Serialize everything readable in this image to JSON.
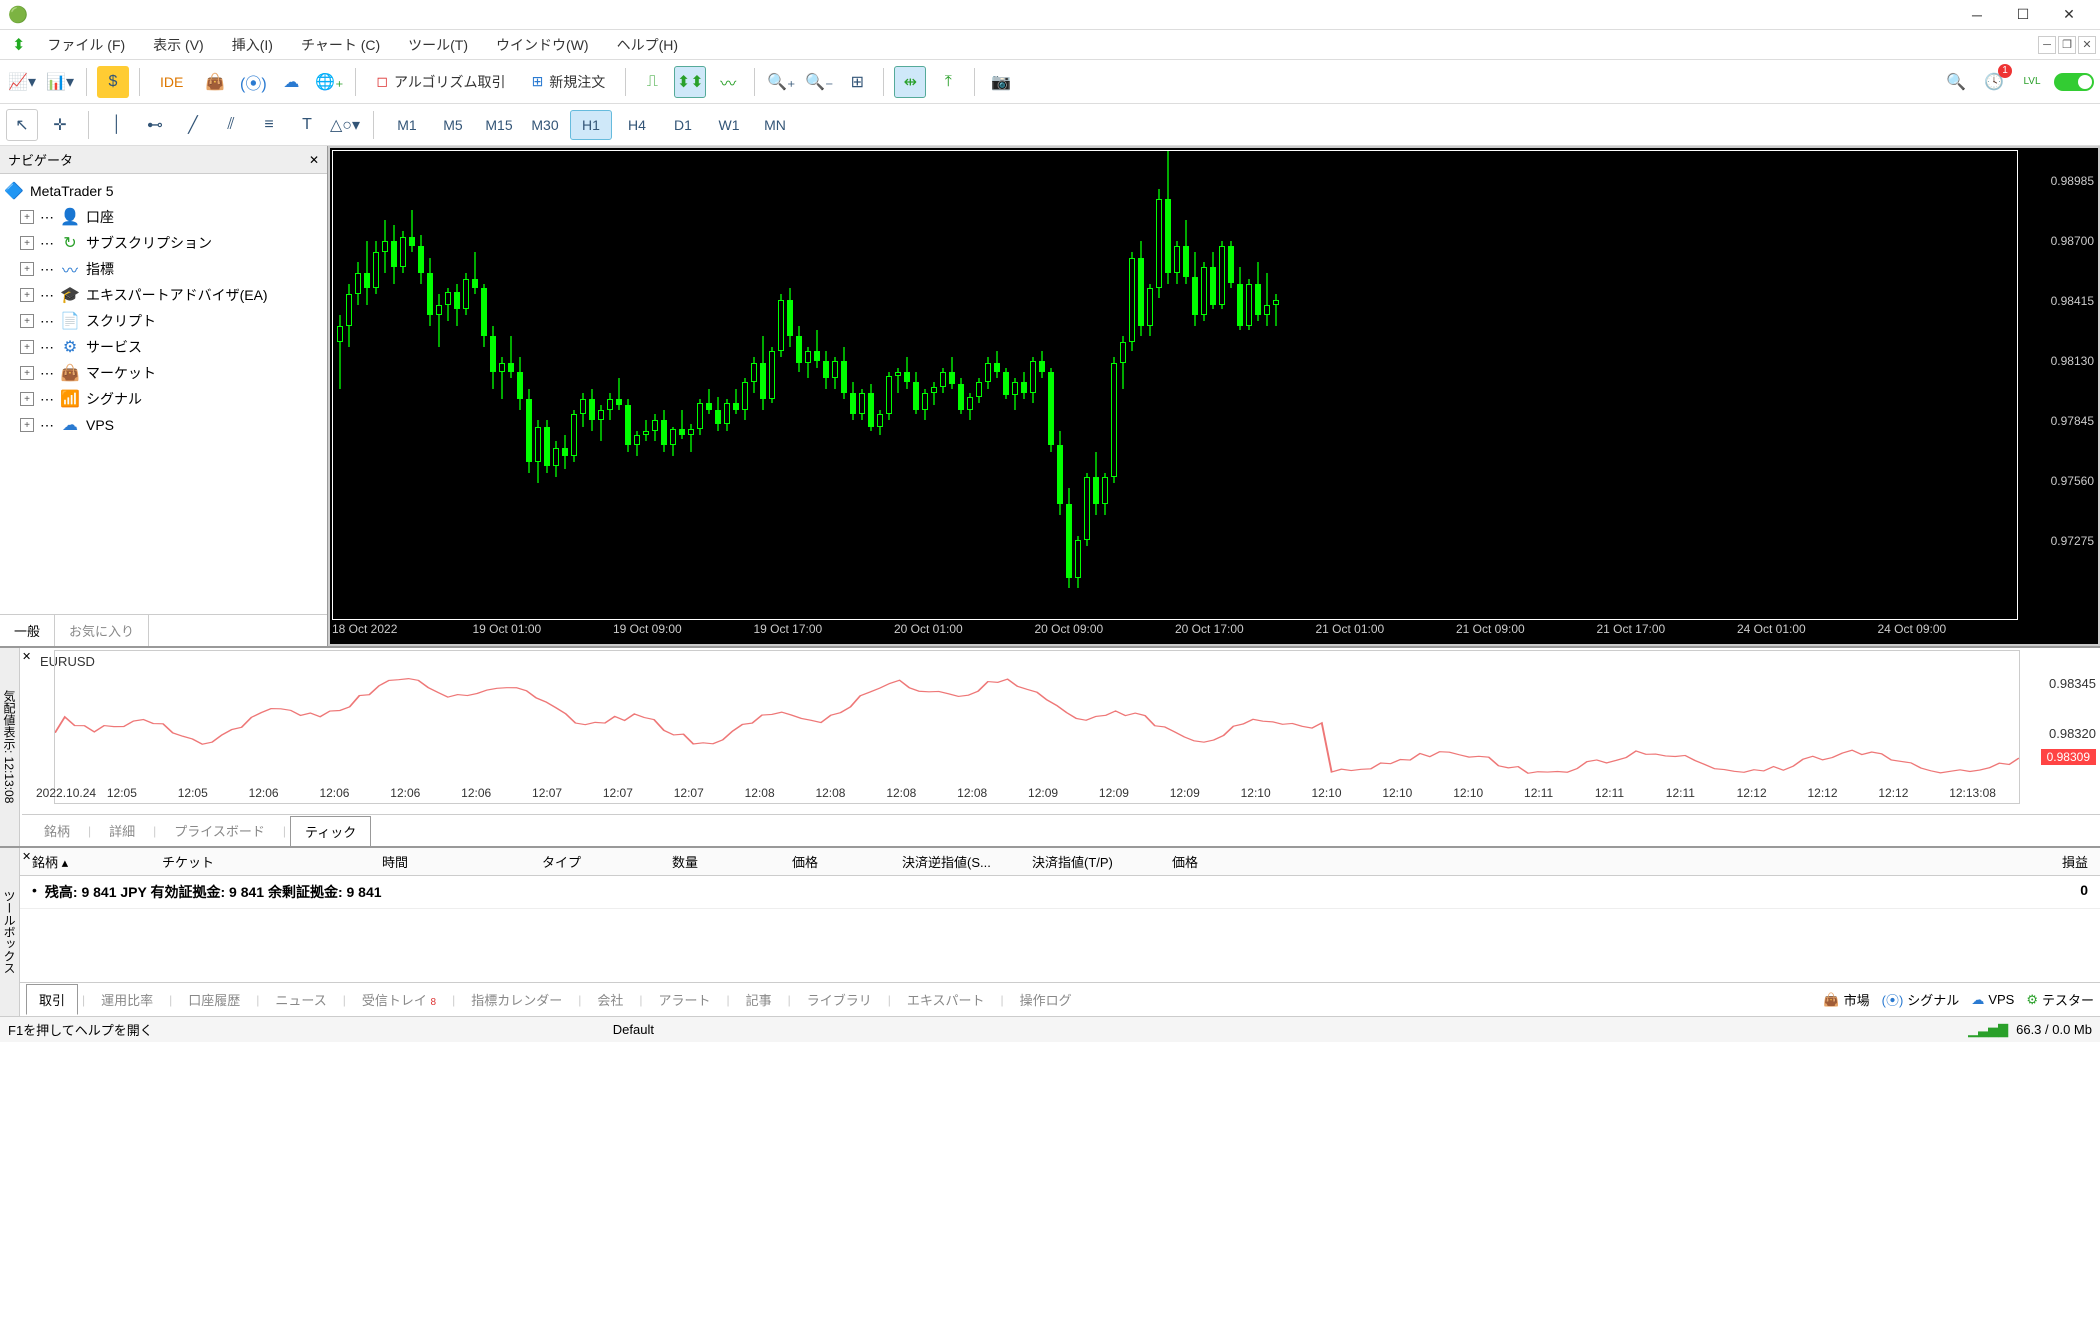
{
  "menubar": {
    "file": "ファイル (F)",
    "view": "表示 (V)",
    "insert": "挿入(I)",
    "chart": "チャート (C)",
    "tool": "ツール(T)",
    "window": "ウインドウ(W)",
    "help": "ヘルプ(H)"
  },
  "toolbar": {
    "ide": "IDE",
    "algo": "アルゴリズム取引",
    "neworder": "新規注文",
    "notif_count": "1"
  },
  "timeframes": [
    "M1",
    "M5",
    "M15",
    "M30",
    "H1",
    "H4",
    "D1",
    "W1",
    "MN"
  ],
  "timeframe_active": "H1",
  "navigator": {
    "title": "ナビゲータ",
    "root": "MetaTrader 5",
    "items": [
      {
        "label": "口座",
        "icon": "👤",
        "col": "#2a7ad1"
      },
      {
        "label": "サブスクリプション",
        "icon": "↻",
        "col": "#2aa02a"
      },
      {
        "label": "指標",
        "icon": "〰",
        "col": "#2a7ad1"
      },
      {
        "label": "エキスパートアドバイザ(EA)",
        "icon": "🎓",
        "col": "#2a7ad1"
      },
      {
        "label": "スクリプト",
        "icon": "📄",
        "col": "#e9a000"
      },
      {
        "label": "サービス",
        "icon": "⚙",
        "col": "#2a7ad1"
      },
      {
        "label": "マーケット",
        "icon": "👜",
        "col": "#e9a000"
      },
      {
        "label": "シグナル",
        "icon": "📶",
        "col": "#2a7ad1"
      },
      {
        "label": "VPS",
        "icon": "☁",
        "col": "#2a7ad1"
      }
    ],
    "tabs": {
      "general": "一般",
      "fav": "お気に入り"
    }
  },
  "chart_data": {
    "type": "candlestick",
    "symbol": "EURUSD",
    "timeframe": "H1",
    "ylim": [
      0.97,
      0.9913
    ],
    "yticks": [
      0.98985,
      0.987,
      0.98415,
      0.9813,
      0.97845,
      0.9756,
      0.97275
    ],
    "xticks": [
      "18 Oct 2022",
      "19 Oct 01:00",
      "19 Oct 09:00",
      "19 Oct 17:00",
      "20 Oct 01:00",
      "20 Oct 09:00",
      "20 Oct 17:00",
      "21 Oct 01:00",
      "21 Oct 09:00",
      "21 Oct 17:00",
      "24 Oct 01:00",
      "24 Oct 09:00"
    ],
    "candles": [
      {
        "o": 0.9822,
        "h": 0.9835,
        "l": 0.98,
        "c": 0.983,
        "d": "up"
      },
      {
        "o": 0.983,
        "h": 0.985,
        "l": 0.982,
        "c": 0.9845,
        "d": "up"
      },
      {
        "o": 0.9845,
        "h": 0.986,
        "l": 0.984,
        "c": 0.9855,
        "d": "up"
      },
      {
        "o": 0.9855,
        "h": 0.987,
        "l": 0.984,
        "c": 0.9848,
        "d": "dn"
      },
      {
        "o": 0.9848,
        "h": 0.987,
        "l": 0.9845,
        "c": 0.9865,
        "d": "up"
      },
      {
        "o": 0.9865,
        "h": 0.988,
        "l": 0.9855,
        "c": 0.987,
        "d": "up"
      },
      {
        "o": 0.987,
        "h": 0.9878,
        "l": 0.985,
        "c": 0.9858,
        "d": "dn"
      },
      {
        "o": 0.9858,
        "h": 0.9875,
        "l": 0.9855,
        "c": 0.9872,
        "d": "up"
      },
      {
        "o": 0.9872,
        "h": 0.9885,
        "l": 0.9865,
        "c": 0.9868,
        "d": "dn"
      },
      {
        "o": 0.9868,
        "h": 0.9873,
        "l": 0.985,
        "c": 0.9855,
        "d": "dn"
      },
      {
        "o": 0.9855,
        "h": 0.9862,
        "l": 0.983,
        "c": 0.9835,
        "d": "dn"
      },
      {
        "o": 0.9835,
        "h": 0.9845,
        "l": 0.982,
        "c": 0.984,
        "d": "up"
      },
      {
        "o": 0.984,
        "h": 0.9848,
        "l": 0.9832,
        "c": 0.9846,
        "d": "up"
      },
      {
        "o": 0.9846,
        "h": 0.985,
        "l": 0.983,
        "c": 0.9838,
        "d": "dn"
      },
      {
        "o": 0.9838,
        "h": 0.9855,
        "l": 0.9835,
        "c": 0.9852,
        "d": "up"
      },
      {
        "o": 0.9852,
        "h": 0.9865,
        "l": 0.9845,
        "c": 0.9848,
        "d": "dn"
      },
      {
        "o": 0.9848,
        "h": 0.985,
        "l": 0.982,
        "c": 0.9825,
        "d": "dn"
      },
      {
        "o": 0.9825,
        "h": 0.983,
        "l": 0.98,
        "c": 0.9808,
        "d": "dn"
      },
      {
        "o": 0.9808,
        "h": 0.9815,
        "l": 0.9795,
        "c": 0.9812,
        "d": "up"
      },
      {
        "o": 0.9812,
        "h": 0.9825,
        "l": 0.9805,
        "c": 0.9808,
        "d": "dn"
      },
      {
        "o": 0.9808,
        "h": 0.9815,
        "l": 0.979,
        "c": 0.9795,
        "d": "dn"
      },
      {
        "o": 0.9795,
        "h": 0.98,
        "l": 0.976,
        "c": 0.9765,
        "d": "dn"
      },
      {
        "o": 0.9765,
        "h": 0.9785,
        "l": 0.9755,
        "c": 0.9782,
        "d": "up"
      },
      {
        "o": 0.9782,
        "h": 0.9785,
        "l": 0.976,
        "c": 0.9763,
        "d": "dn"
      },
      {
        "o": 0.9763,
        "h": 0.9775,
        "l": 0.9758,
        "c": 0.9772,
        "d": "up"
      },
      {
        "o": 0.9772,
        "h": 0.9778,
        "l": 0.9762,
        "c": 0.9768,
        "d": "dn"
      },
      {
        "o": 0.9768,
        "h": 0.979,
        "l": 0.9765,
        "c": 0.9788,
        "d": "up"
      },
      {
        "o": 0.9788,
        "h": 0.9798,
        "l": 0.9782,
        "c": 0.9795,
        "d": "up"
      },
      {
        "o": 0.9795,
        "h": 0.98,
        "l": 0.978,
        "c": 0.9785,
        "d": "dn"
      },
      {
        "o": 0.9785,
        "h": 0.9792,
        "l": 0.9775,
        "c": 0.979,
        "d": "up"
      },
      {
        "o": 0.979,
        "h": 0.9798,
        "l": 0.9785,
        "c": 0.9795,
        "d": "up"
      },
      {
        "o": 0.9795,
        "h": 0.9805,
        "l": 0.979,
        "c": 0.9792,
        "d": "dn"
      },
      {
        "o": 0.9792,
        "h": 0.9795,
        "l": 0.977,
        "c": 0.9773,
        "d": "dn"
      },
      {
        "o": 0.9773,
        "h": 0.978,
        "l": 0.9768,
        "c": 0.9778,
        "d": "up"
      },
      {
        "o": 0.9778,
        "h": 0.9785,
        "l": 0.9775,
        "c": 0.978,
        "d": "up"
      },
      {
        "o": 0.978,
        "h": 0.9788,
        "l": 0.9775,
        "c": 0.9785,
        "d": "up"
      },
      {
        "o": 0.9785,
        "h": 0.979,
        "l": 0.977,
        "c": 0.9773,
        "d": "dn"
      },
      {
        "o": 0.9773,
        "h": 0.9782,
        "l": 0.9768,
        "c": 0.9781,
        "d": "up"
      },
      {
        "o": 0.9781,
        "h": 0.979,
        "l": 0.9776,
        "c": 0.9778,
        "d": "dn"
      },
      {
        "o": 0.9778,
        "h": 0.9783,
        "l": 0.977,
        "c": 0.9781,
        "d": "up"
      },
      {
        "o": 0.9781,
        "h": 0.9795,
        "l": 0.9778,
        "c": 0.9793,
        "d": "up"
      },
      {
        "o": 0.9793,
        "h": 0.98,
        "l": 0.9788,
        "c": 0.979,
        "d": "dn"
      },
      {
        "o": 0.979,
        "h": 0.9796,
        "l": 0.978,
        "c": 0.9783,
        "d": "dn"
      },
      {
        "o": 0.9783,
        "h": 0.9795,
        "l": 0.978,
        "c": 0.9793,
        "d": "up"
      },
      {
        "o": 0.9793,
        "h": 0.98,
        "l": 0.9788,
        "c": 0.979,
        "d": "dn"
      },
      {
        "o": 0.979,
        "h": 0.9805,
        "l": 0.9785,
        "c": 0.9803,
        "d": "up"
      },
      {
        "o": 0.9803,
        "h": 0.9815,
        "l": 0.9798,
        "c": 0.9812,
        "d": "up"
      },
      {
        "o": 0.9812,
        "h": 0.9825,
        "l": 0.979,
        "c": 0.9795,
        "d": "dn"
      },
      {
        "o": 0.9795,
        "h": 0.982,
        "l": 0.9793,
        "c": 0.9818,
        "d": "up"
      },
      {
        "o": 0.9818,
        "h": 0.9845,
        "l": 0.9815,
        "c": 0.9842,
        "d": "up"
      },
      {
        "o": 0.9842,
        "h": 0.9848,
        "l": 0.982,
        "c": 0.9825,
        "d": "dn"
      },
      {
        "o": 0.9825,
        "h": 0.983,
        "l": 0.9808,
        "c": 0.9812,
        "d": "dn"
      },
      {
        "o": 0.9812,
        "h": 0.982,
        "l": 0.9805,
        "c": 0.9818,
        "d": "up"
      },
      {
        "o": 0.9818,
        "h": 0.9828,
        "l": 0.981,
        "c": 0.9813,
        "d": "dn"
      },
      {
        "o": 0.9813,
        "h": 0.9818,
        "l": 0.98,
        "c": 0.9805,
        "d": "dn"
      },
      {
        "o": 0.9805,
        "h": 0.9815,
        "l": 0.98,
        "c": 0.9813,
        "d": "up"
      },
      {
        "o": 0.9813,
        "h": 0.982,
        "l": 0.9795,
        "c": 0.9798,
        "d": "dn"
      },
      {
        "o": 0.9798,
        "h": 0.9803,
        "l": 0.9785,
        "c": 0.9788,
        "d": "dn"
      },
      {
        "o": 0.9788,
        "h": 0.98,
        "l": 0.9785,
        "c": 0.9798,
        "d": "up"
      },
      {
        "o": 0.9798,
        "h": 0.9802,
        "l": 0.978,
        "c": 0.9782,
        "d": "dn"
      },
      {
        "o": 0.9782,
        "h": 0.979,
        "l": 0.9778,
        "c": 0.9788,
        "d": "up"
      },
      {
        "o": 0.9788,
        "h": 0.9808,
        "l": 0.9785,
        "c": 0.9806,
        "d": "up"
      },
      {
        "o": 0.9806,
        "h": 0.981,
        "l": 0.9798,
        "c": 0.9808,
        "d": "up"
      },
      {
        "o": 0.9808,
        "h": 0.9815,
        "l": 0.98,
        "c": 0.9803,
        "d": "dn"
      },
      {
        "o": 0.9803,
        "h": 0.9808,
        "l": 0.9788,
        "c": 0.979,
        "d": "dn"
      },
      {
        "o": 0.979,
        "h": 0.98,
        "l": 0.9785,
        "c": 0.9798,
        "d": "up"
      },
      {
        "o": 0.9798,
        "h": 0.9803,
        "l": 0.9792,
        "c": 0.9801,
        "d": "up"
      },
      {
        "o": 0.9801,
        "h": 0.981,
        "l": 0.9798,
        "c": 0.9808,
        "d": "up"
      },
      {
        "o": 0.9808,
        "h": 0.9815,
        "l": 0.98,
        "c": 0.9802,
        "d": "dn"
      },
      {
        "o": 0.9802,
        "h": 0.9805,
        "l": 0.9788,
        "c": 0.979,
        "d": "dn"
      },
      {
        "o": 0.979,
        "h": 0.9798,
        "l": 0.9785,
        "c": 0.9796,
        "d": "up"
      },
      {
        "o": 0.9796,
        "h": 0.9805,
        "l": 0.9793,
        "c": 0.9803,
        "d": "up"
      },
      {
        "o": 0.9803,
        "h": 0.9815,
        "l": 0.98,
        "c": 0.9812,
        "d": "up"
      },
      {
        "o": 0.9812,
        "h": 0.9818,
        "l": 0.9805,
        "c": 0.9808,
        "d": "dn"
      },
      {
        "o": 0.9808,
        "h": 0.981,
        "l": 0.9795,
        "c": 0.9797,
        "d": "dn"
      },
      {
        "o": 0.9797,
        "h": 0.9805,
        "l": 0.979,
        "c": 0.9803,
        "d": "up"
      },
      {
        "o": 0.9803,
        "h": 0.9808,
        "l": 0.9795,
        "c": 0.9798,
        "d": "dn"
      },
      {
        "o": 0.9798,
        "h": 0.9815,
        "l": 0.9793,
        "c": 0.9813,
        "d": "up"
      },
      {
        "o": 0.9813,
        "h": 0.9818,
        "l": 0.9805,
        "c": 0.9808,
        "d": "dn"
      },
      {
        "o": 0.9808,
        "h": 0.981,
        "l": 0.977,
        "c": 0.9773,
        "d": "dn"
      },
      {
        "o": 0.9773,
        "h": 0.978,
        "l": 0.974,
        "c": 0.9745,
        "d": "dn"
      },
      {
        "o": 0.9745,
        "h": 0.9753,
        "l": 0.9705,
        "c": 0.971,
        "d": "dn"
      },
      {
        "o": 0.971,
        "h": 0.973,
        "l": 0.9705,
        "c": 0.9728,
        "d": "up"
      },
      {
        "o": 0.9728,
        "h": 0.976,
        "l": 0.9725,
        "c": 0.9758,
        "d": "up"
      },
      {
        "o": 0.9758,
        "h": 0.977,
        "l": 0.974,
        "c": 0.9745,
        "d": "dn"
      },
      {
        "o": 0.9745,
        "h": 0.976,
        "l": 0.974,
        "c": 0.9758,
        "d": "up"
      },
      {
        "o": 0.9758,
        "h": 0.9815,
        "l": 0.9755,
        "c": 0.9812,
        "d": "up"
      },
      {
        "o": 0.9812,
        "h": 0.9825,
        "l": 0.98,
        "c": 0.9822,
        "d": "up"
      },
      {
        "o": 0.9822,
        "h": 0.9865,
        "l": 0.9818,
        "c": 0.9862,
        "d": "up"
      },
      {
        "o": 0.9862,
        "h": 0.987,
        "l": 0.9825,
        "c": 0.983,
        "d": "dn"
      },
      {
        "o": 0.983,
        "h": 0.985,
        "l": 0.9825,
        "c": 0.9848,
        "d": "up"
      },
      {
        "o": 0.9848,
        "h": 0.9895,
        "l": 0.9843,
        "c": 0.989,
        "d": "up"
      },
      {
        "o": 0.989,
        "h": 0.9913,
        "l": 0.985,
        "c": 0.9855,
        "d": "dn"
      },
      {
        "o": 0.9855,
        "h": 0.987,
        "l": 0.985,
        "c": 0.9868,
        "d": "up"
      },
      {
        "o": 0.9868,
        "h": 0.988,
        "l": 0.985,
        "c": 0.9853,
        "d": "dn"
      },
      {
        "o": 0.9853,
        "h": 0.9865,
        "l": 0.983,
        "c": 0.9835,
        "d": "dn"
      },
      {
        "o": 0.9835,
        "h": 0.986,
        "l": 0.9832,
        "c": 0.9858,
        "d": "up"
      },
      {
        "o": 0.9858,
        "h": 0.9865,
        "l": 0.9838,
        "c": 0.984,
        "d": "dn"
      },
      {
        "o": 0.984,
        "h": 0.987,
        "l": 0.9838,
        "c": 0.9868,
        "d": "up"
      },
      {
        "o": 0.9868,
        "h": 0.987,
        "l": 0.9848,
        "c": 0.985,
        "d": "dn"
      },
      {
        "o": 0.985,
        "h": 0.9858,
        "l": 0.9828,
        "c": 0.983,
        "d": "dn"
      },
      {
        "o": 0.983,
        "h": 0.9852,
        "l": 0.9828,
        "c": 0.985,
        "d": "up"
      },
      {
        "o": 0.985,
        "h": 0.986,
        "l": 0.9832,
        "c": 0.9835,
        "d": "dn"
      },
      {
        "o": 0.9835,
        "h": 0.9855,
        "l": 0.983,
        "c": 0.984,
        "d": "up"
      },
      {
        "o": 0.984,
        "h": 0.9845,
        "l": 0.983,
        "c": 0.9842,
        "d": "up"
      }
    ]
  },
  "tick": {
    "side_label": "気配値表示: 12:13:08",
    "symbol": "EURUSD",
    "yticks": [
      "0.98345",
      "0.98320"
    ],
    "current": "0.98309",
    "xticks": [
      "2022.10.24",
      "12:05",
      "12:05",
      "12:06",
      "12:06",
      "12:06",
      "12:06",
      "12:07",
      "12:07",
      "12:07",
      "12:08",
      "12:08",
      "12:08",
      "12:08",
      "12:09",
      "12:09",
      "12:09",
      "12:10",
      "12:10",
      "12:10",
      "12:10",
      "12:11",
      "12:11",
      "12:11",
      "12:12",
      "12:12",
      "12:12",
      "12:13:08"
    ],
    "tabs": [
      "銘柄",
      "詳細",
      "プライスボード",
      "ティック"
    ],
    "active_tab": "ティック"
  },
  "toolbox": {
    "side_label": "ツールボックス",
    "headers": [
      "銘柄",
      "チケット",
      "時間",
      "タイプ",
      "数量",
      "価格",
      "決済逆指値(S...",
      "決済指値(T/P)",
      "価格",
      "損益"
    ],
    "balance_row": "残高: 9 841 JPY  有効証拠金: 9 841  余剰証拠金: 9 841",
    "balance_right": "0",
    "tabs": [
      "取引",
      "運用比率",
      "口座履歴",
      "ニュース",
      "受信トレイ",
      "指標カレンダー",
      "会社",
      "アラート",
      "記事",
      "ライブラリ",
      "エキスパート",
      "操作ログ"
    ],
    "active_tab": "取引",
    "inbox_badge": "8",
    "right": {
      "market": "市場",
      "signal": "シグナル",
      "vps": "VPS",
      "tester": "テスター"
    }
  },
  "status": {
    "help": "F1を押してヘルプを開く",
    "profile": "Default",
    "conn": "66.3 / 0.0 Mb"
  }
}
